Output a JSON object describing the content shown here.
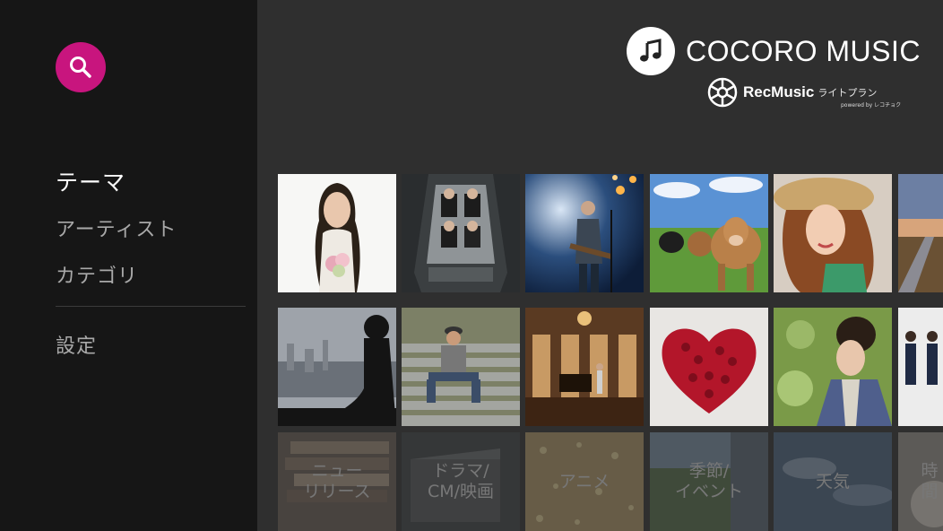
{
  "sidebar": {
    "nav": [
      {
        "label": "テーマ",
        "active": true
      },
      {
        "label": "アーティスト",
        "active": false
      },
      {
        "label": "カテゴリ",
        "active": false
      }
    ],
    "settings_label": "設定",
    "accent": "#c8157e"
  },
  "brand": {
    "title": "COCORO MUSIC",
    "partner_name": "RecMusic",
    "partner_plan": "ライトプラン",
    "partner_powered": "powered by レコチョク"
  },
  "categories": [
    {
      "label": "ニュー\nリリース"
    },
    {
      "label": "ドラマ/\nCM/映画"
    },
    {
      "label": "アニメ"
    },
    {
      "label": "季節/\nイベント"
    },
    {
      "label": "天気"
    },
    {
      "label": "時間"
    }
  ],
  "colors": {
    "sidebar_bg": "#161616",
    "main_bg": "#2f2f2f"
  }
}
